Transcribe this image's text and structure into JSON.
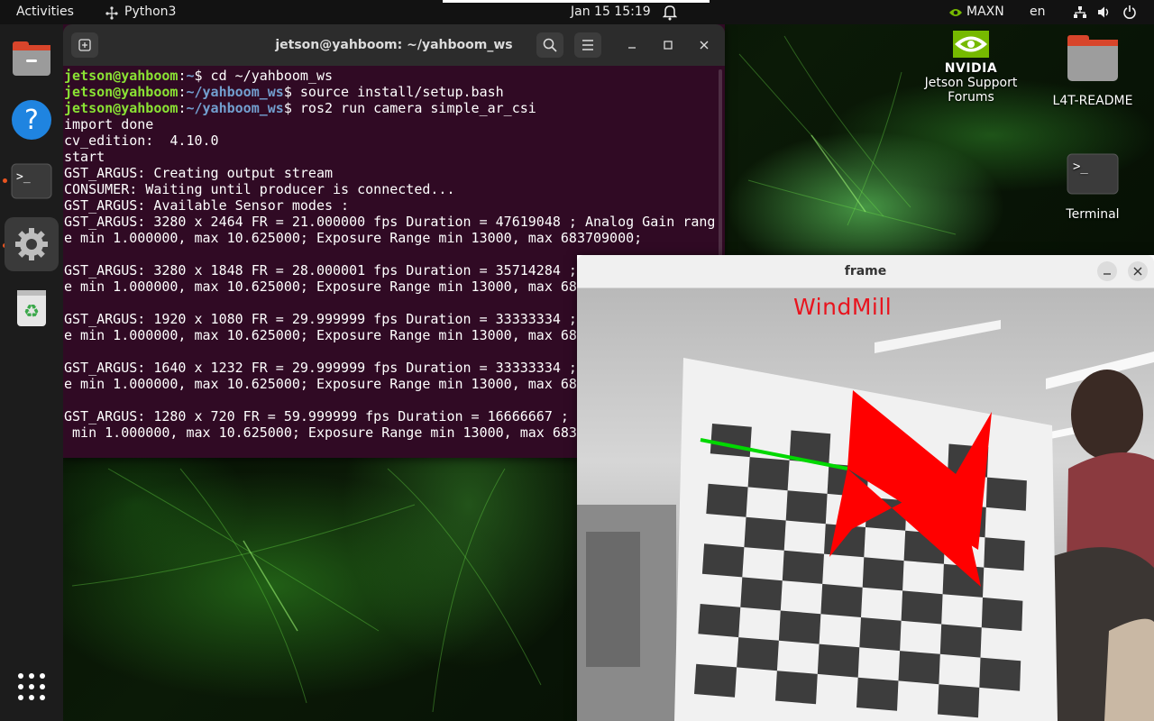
{
  "topbar": {
    "activities": "Activities",
    "app_name": "Python3",
    "clock": "Jan 15  15:19",
    "power_mode": "MAXN",
    "language": "en"
  },
  "dock": {
    "items": [
      "files-icon",
      "help-icon",
      "terminal-icon",
      "settings-icon",
      "trash-icon"
    ],
    "apps_grid": "show-apps-icon",
    "accent": "#e95420"
  },
  "desktop": {
    "nvidia_logo_text": "NVIDIA",
    "forums_label_1": "Jetson Support",
    "forums_label_2": "Forums",
    "readme_label": "L4T-README",
    "terminal_label": "Terminal"
  },
  "terminal": {
    "title": "jetson@yahboom: ~/yahboom_ws",
    "user": "jetson@yahboom",
    "lines": [
      {
        "path": "~",
        "cmd": "$ cd ~/yahboom_ws"
      },
      {
        "path": "~/yahboom_ws",
        "cmd": "$ source install/setup.bash"
      },
      {
        "path": "~/yahboom_ws",
        "cmd": "$ ros2 run camera simple_ar_csi"
      }
    ],
    "output": [
      "import done",
      "cv_edition:  4.10.0",
      "start",
      "GST_ARGUS: Creating output stream",
      "CONSUMER: Waiting until producer is connected...",
      "GST_ARGUS: Available Sensor modes :",
      "GST_ARGUS: 3280 x 2464 FR = 21.000000 fps Duration = 47619048 ; Analog Gain rang",
      "e min 1.000000, max 10.625000; Exposure Range min 13000, max 683709000;",
      "",
      "GST_ARGUS: 3280 x 1848 FR = 28.000001 fps Duration = 35714284 ;",
      "e min 1.000000, max 10.625000; Exposure Range min 13000, max 68",
      "",
      "GST_ARGUS: 1920 x 1080 FR = 29.999999 fps Duration = 33333334 ;",
      "e min 1.000000, max 10.625000; Exposure Range min 13000, max 68",
      "",
      "GST_ARGUS: 1640 x 1232 FR = 29.999999 fps Duration = 33333334 ;",
      "e min 1.000000, max 10.625000; Exposure Range min 13000, max 68",
      "",
      "GST_ARGUS: 1280 x 720 FR = 59.999999 fps Duration = 16666667 ;",
      " min 1.000000, max 10.625000; Exposure Range min 13000, max 683"
    ],
    "bg_color": "#300a24"
  },
  "frame": {
    "title": "frame",
    "overlay_label": "WindMill",
    "overlay_color": "#ff0000",
    "axis_color": "#00d800"
  }
}
